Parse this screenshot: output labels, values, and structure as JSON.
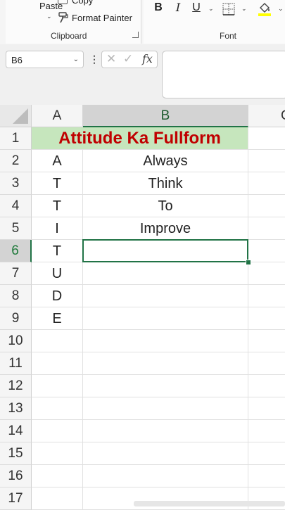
{
  "ribbon": {
    "clipboard": {
      "paste_label": "Paste",
      "copy_label": "Copy",
      "format_painter_label": "Format Painter",
      "group_label": "Clipboard"
    },
    "font": {
      "bold": "B",
      "italic": "I",
      "underline": "U",
      "group_label": "Font"
    }
  },
  "formula_bar": {
    "name_box": "B6",
    "fx_label": "fx",
    "formula": ""
  },
  "sheet": {
    "columns": [
      "A",
      "B",
      "C"
    ],
    "rows": [
      "1",
      "2",
      "3",
      "4",
      "5",
      "6",
      "7",
      "8",
      "9",
      "10",
      "11",
      "12",
      "13",
      "14",
      "15",
      "16",
      "17"
    ],
    "title": "Attitude Ka Fullform",
    "col_a": [
      "A",
      "T",
      "T",
      "I",
      "T",
      "U",
      "D",
      "E"
    ],
    "col_b": [
      "Always",
      "Think",
      "To",
      "Improve"
    ],
    "selected_cell": "B6"
  },
  "colors": {
    "accent": "#217346",
    "title_fill": "#c6e6bd",
    "title_text": "#c00000"
  }
}
